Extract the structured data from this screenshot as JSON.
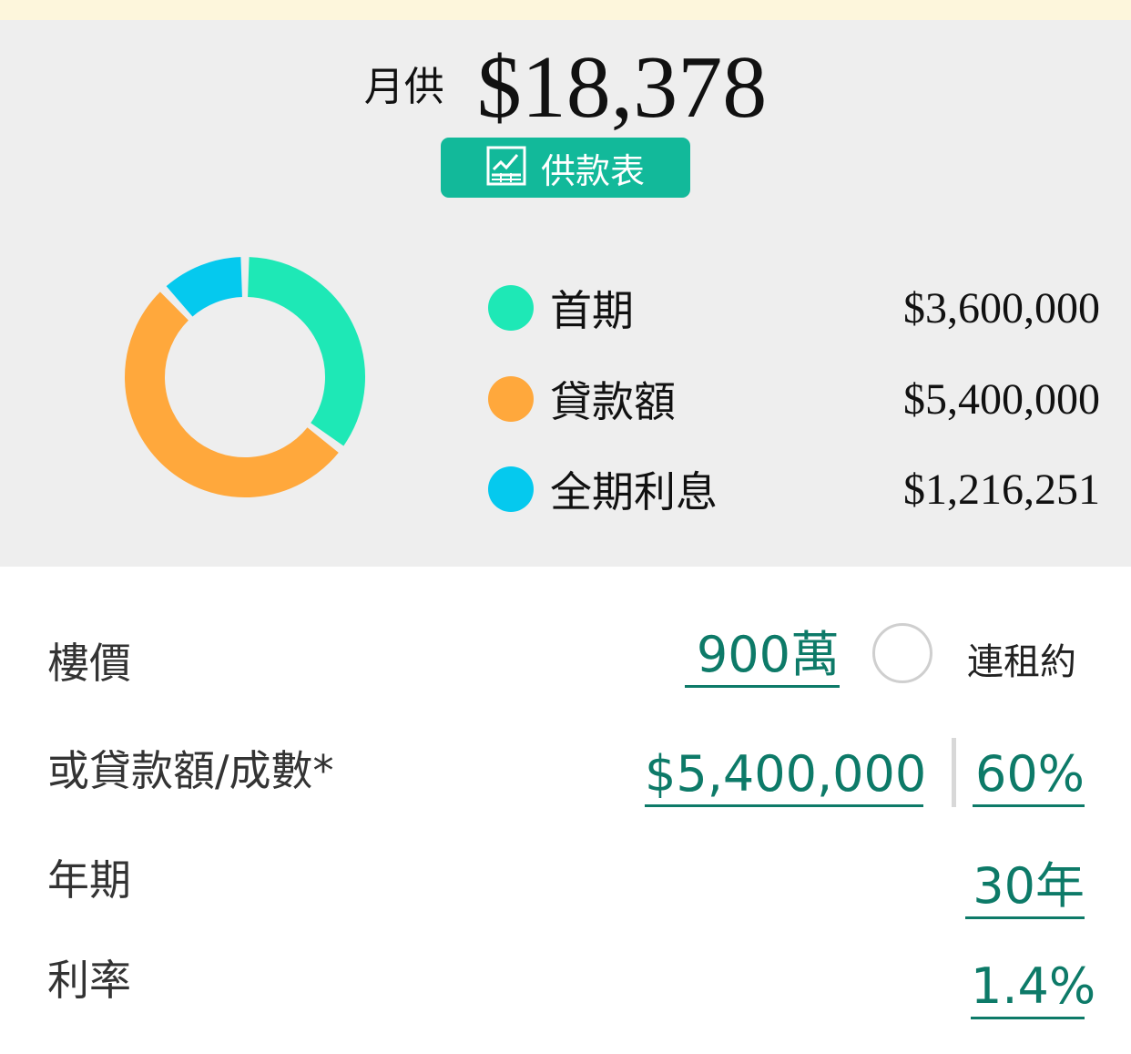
{
  "summary": {
    "monthly_label": "月供",
    "monthly_value": "$18,378",
    "schedule_button": "供款表",
    "breakdown": [
      {
        "label": "首期",
        "value": "$3,600,000",
        "color": "#1ee8b6"
      },
      {
        "label": "貸款額",
        "value": "$5,400,000",
        "color": "#ffa83c"
      },
      {
        "label": "全期利息",
        "value": "$1,216,251",
        "color": "#05c9ee"
      }
    ]
  },
  "chart_data": {
    "type": "pie",
    "style": "donut",
    "slices": [
      {
        "label": "首期",
        "value": 3600000,
        "color": "#1ee8b6"
      },
      {
        "label": "貸款額",
        "value": 5400000,
        "color": "#ffa83c"
      },
      {
        "label": "全期利息",
        "value": 1216251,
        "color": "#05c9ee"
      }
    ]
  },
  "form": {
    "price_label": "樓價",
    "price_value": "900萬",
    "lease_label": "連租約",
    "loan_label": "或貸款額/成數*",
    "loan_amount": "$5,400,000",
    "loan_ratio": "60%",
    "term_label": "年期",
    "term_value": "30年",
    "rate_label": "利率",
    "rate_value": "1.4%"
  },
  "colors": {
    "accent": "#0d7a68",
    "button": "#12b99a",
    "summary_bg": "#eeeeee",
    "top_strip": "#fdf6dc"
  },
  "icons": {
    "schedule_button": "chart-table-icon",
    "lease_toggle": "radio-circle-icon"
  }
}
